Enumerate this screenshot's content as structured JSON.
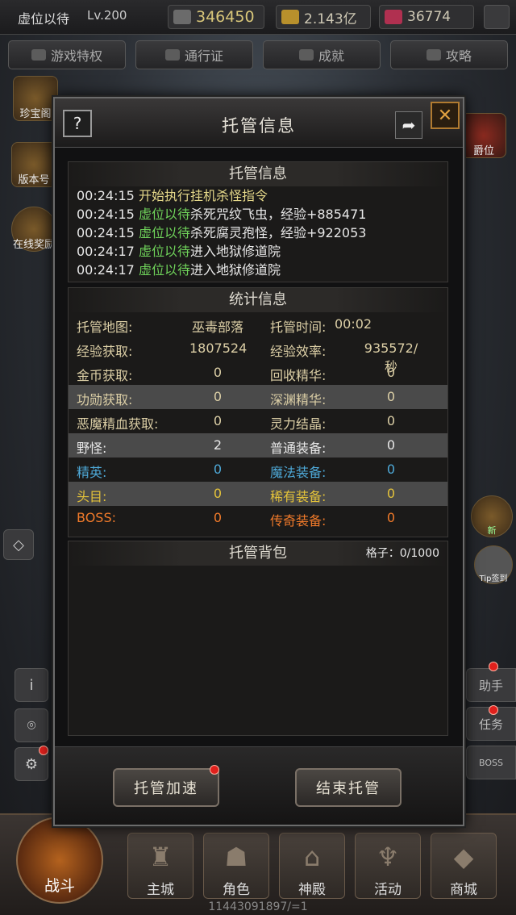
{
  "topbar": {
    "player_name": "虚位以待",
    "level": "Lv.200",
    "power": "346450",
    "gold": "2.143亿",
    "gems": "36774"
  },
  "nav_tabs": [
    "游戏特权",
    "通行证",
    "成就",
    "攻略"
  ],
  "side_left": [
    "珍宝阁",
    "版本号",
    "在线奖励"
  ],
  "side_right": {
    "rank": "爵位",
    "tip": "Tip签到",
    "f1": "助手",
    "f2": "任务",
    "f3": "BOSS",
    "new": "新"
  },
  "bottom_nav": {
    "battle": "战斗",
    "items": [
      "主城",
      "角色",
      "神殿",
      "活动",
      "商城"
    ]
  },
  "footer_id": "11443091897/=1",
  "modal": {
    "title": "托管信息",
    "help_icon": "?",
    "log": {
      "title": "托管信息",
      "lines": [
        {
          "time": "00:24:15",
          "actor": "",
          "text": "开始执行挂机杀怪指令"
        },
        {
          "time": "00:24:15",
          "actor": "虚位以待",
          "text": "杀死咒纹飞虫，经验+885471"
        },
        {
          "time": "00:24:15",
          "actor": "虚位以待",
          "text": "杀死腐灵孢怪，经验+922053"
        },
        {
          "time": "00:24:17",
          "actor": "虚位以待",
          "text": "进入地狱修道院"
        },
        {
          "time": "00:24:17",
          "actor": "虚位以待",
          "text": "进入地狱修道院"
        }
      ]
    },
    "stats": {
      "title": "统计信息",
      "rows": [
        {
          "l1": "托管地图:",
          "v1": "巫毒部落",
          "l2": "托管时间:",
          "v2": "00:02",
          "style": "norm"
        },
        {
          "l1": "经验获取:",
          "v1": "1807524",
          "l2": "经验效率:",
          "v2": "935572/秒",
          "style": "norm"
        },
        {
          "l1": "金币获取:",
          "v1": "0",
          "l2": "回收精华:",
          "v2": "0",
          "style": "norm"
        },
        {
          "l1": "功勋获取:",
          "v1": "0",
          "l2": "深渊精华:",
          "v2": "0",
          "style": "norm"
        },
        {
          "l1": "恶魔精血获取:",
          "v1": "0",
          "l2": "灵力结晶:",
          "v2": "0",
          "style": "norm"
        },
        {
          "l1": "野怪:",
          "v1": "2",
          "l2": "普通装备:",
          "v2": "0",
          "style": "white"
        },
        {
          "l1": "精英:",
          "v1": "0",
          "l2": "魔法装备:",
          "v2": "0",
          "style": "blue"
        },
        {
          "l1": "头目:",
          "v1": "0",
          "l2": "稀有装备:",
          "v2": "0",
          "style": "gold"
        },
        {
          "l1": "BOSS:",
          "v1": "0",
          "l2": "传奇装备:",
          "v2": "0",
          "style": "orange"
        }
      ]
    },
    "bag": {
      "title": "托管背包",
      "slots_label": "格子：0/1000"
    },
    "buttons": {
      "speedup": "托管加速",
      "end": "结束托管"
    }
  }
}
